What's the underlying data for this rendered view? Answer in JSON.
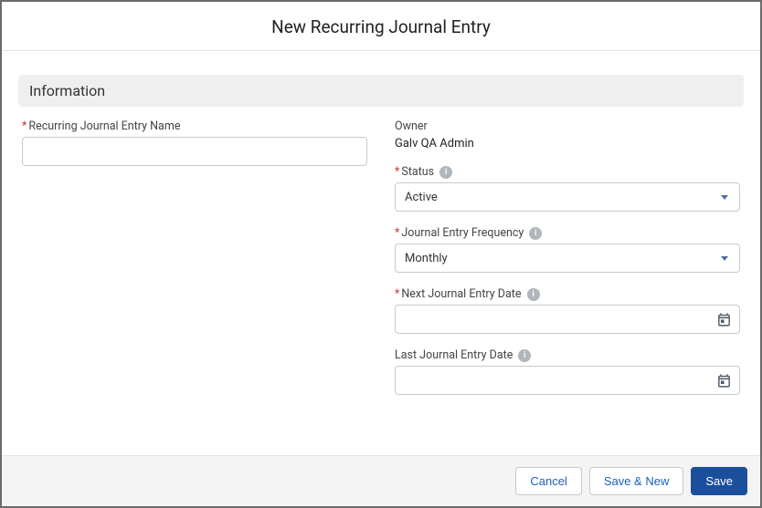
{
  "modal": {
    "title": "New Recurring Journal Entry"
  },
  "section": {
    "information": "Information"
  },
  "fields": {
    "name": {
      "label": "Recurring Journal Entry Name",
      "value": ""
    },
    "owner": {
      "label": "Owner",
      "value": "Galv QA Admin"
    },
    "status": {
      "label": "Status",
      "value": "Active"
    },
    "frequency": {
      "label": "Journal Entry Frequency",
      "value": "Monthly"
    },
    "nextDate": {
      "label": "Next Journal Entry Date",
      "value": ""
    },
    "lastDate": {
      "label": "Last Journal Entry Date",
      "value": ""
    }
  },
  "footer": {
    "cancel": "Cancel",
    "saveNew": "Save & New",
    "save": "Save"
  }
}
